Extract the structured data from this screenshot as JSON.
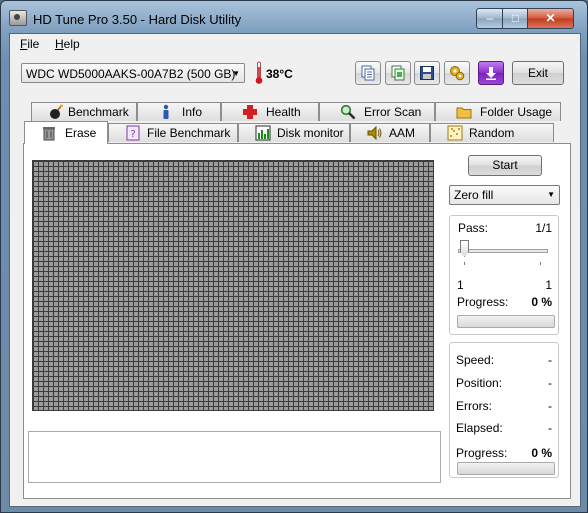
{
  "window": {
    "title": "HD Tune Pro 3.50 - Hard Disk Utility",
    "min_glyph": "–",
    "max_glyph": "□",
    "close_glyph": "✕"
  },
  "menu": {
    "items": [
      "File",
      "Help"
    ]
  },
  "toolbar": {
    "drive": "WDC WD5000AAKS-00A7B2 (500 GB)",
    "temperature": "38°C",
    "exit_label": "Exit",
    "buttons": [
      "copy-text-icon",
      "copy-screenshot-icon",
      "save-icon",
      "options-icon",
      "download-icon"
    ]
  },
  "tabs": {
    "row1": [
      "Benchmark",
      "Info",
      "Health",
      "Error Scan",
      "Folder Usage"
    ],
    "row2": [
      "Erase",
      "File Benchmark",
      "Disk monitor",
      "AAM",
      "Random Access"
    ],
    "active": "Erase"
  },
  "erase": {
    "start_label": "Start",
    "mode": "Zero fill",
    "pass": {
      "label": "Pass:",
      "value": "1/1",
      "min": "1",
      "max": "1"
    },
    "progress1": {
      "label": "Progress:",
      "value": "0 %",
      "fraction": 0
    },
    "stats": [
      {
        "label": "Speed:",
        "value": "-"
      },
      {
        "label": "Position:",
        "value": "-"
      },
      {
        "label": "Errors:",
        "value": "-"
      },
      {
        "label": "Elapsed:",
        "value": "-"
      }
    ],
    "progress2": {
      "label": "Progress:",
      "value": "0 %",
      "fraction": 0
    }
  },
  "colors": {
    "grid_cell": "#9b9b9b",
    "grid_line": "#3b3b3b",
    "health_cross": "#d22020",
    "download_bg": "#8b2fc9"
  }
}
